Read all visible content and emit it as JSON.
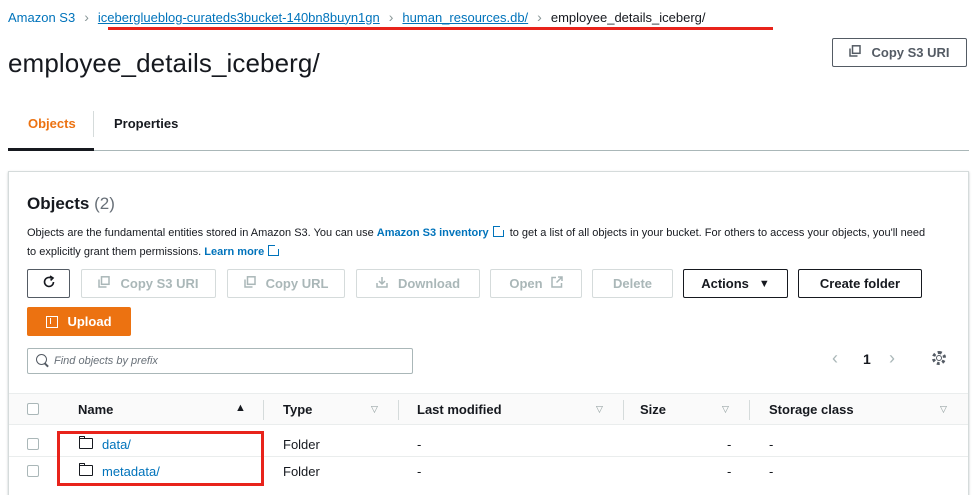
{
  "breadcrumb": {
    "root": "Amazon S3",
    "bucket": "iceberglueblog-curateds3bucket-140bn8buyn1gn",
    "database": "human_resources.db/",
    "current": "employee_details_iceberg/"
  },
  "page": {
    "title": "employee_details_iceberg/",
    "copy_uri_label": "Copy S3 URI"
  },
  "tabs": [
    {
      "label": "Objects",
      "active": true
    },
    {
      "label": "Properties",
      "active": false
    }
  ],
  "objects_panel": {
    "title": "Objects",
    "count": "(2)",
    "description_part1": "Objects are the fundamental entities stored in Amazon S3. You can use ",
    "inventory_link": "Amazon S3 inventory",
    "description_part2": " to get a list of all objects in your bucket. For others to access your objects, you'll need to explicitly grant them permissions. ",
    "learn_more": "Learn more",
    "toolbar": {
      "refresh": "refresh",
      "copy_s3_uri": "Copy S3 URI",
      "copy_url": "Copy URL",
      "download": "Download",
      "open": "Open",
      "delete": "Delete",
      "actions": "Actions",
      "create_folder": "Create folder",
      "upload": "Upload"
    },
    "search_placeholder": "Find objects by prefix",
    "pagination": {
      "current_page": "1"
    }
  },
  "table": {
    "columns": [
      "Name",
      "Type",
      "Last modified",
      "Size",
      "Storage class"
    ],
    "rows": [
      {
        "name": "data/",
        "type": "Folder",
        "last_modified": "-",
        "size": "-",
        "storage_class": "-"
      },
      {
        "name": "metadata/",
        "type": "Folder",
        "last_modified": "-",
        "size": "-",
        "storage_class": "-"
      }
    ]
  },
  "colors": {
    "accent_orange": "#ec7211",
    "link_blue": "#0073bb",
    "annotation_red": "#e8231b"
  }
}
